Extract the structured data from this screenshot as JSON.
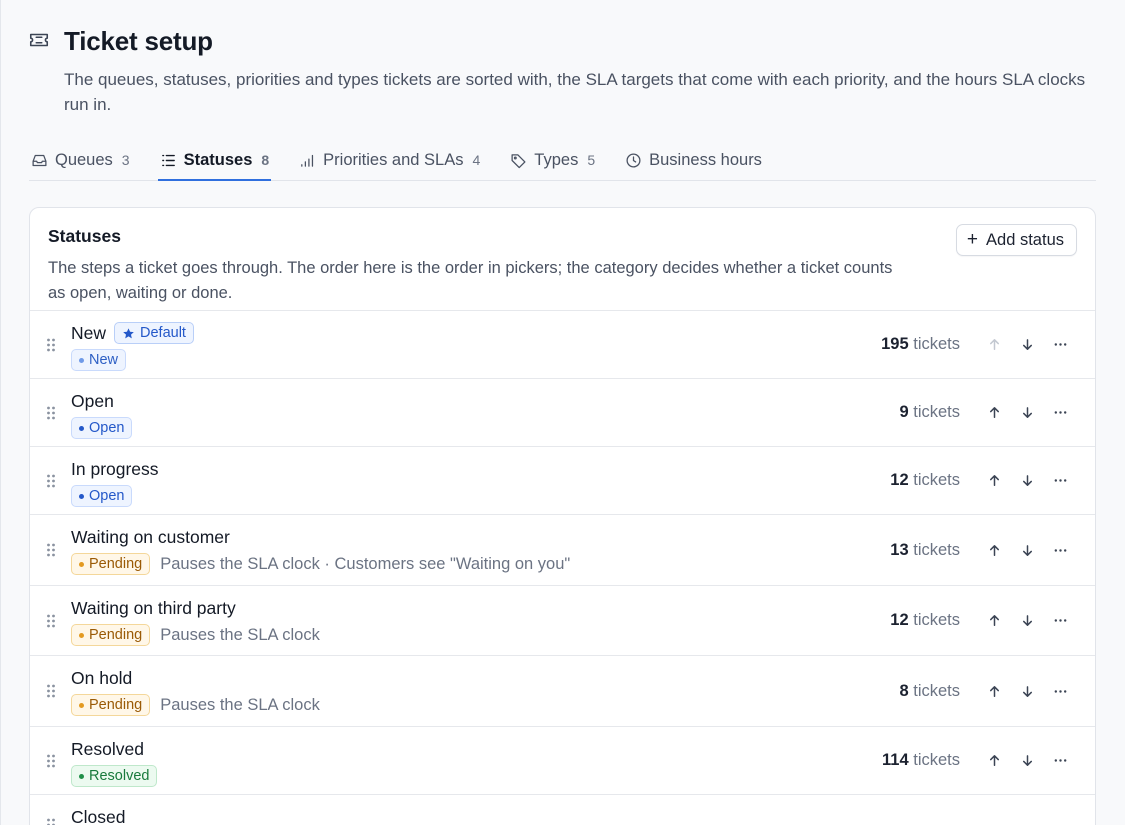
{
  "header": {
    "title": "Ticket setup",
    "subtitle": "The queues, statuses, priorities and types tickets are sorted with, the SLA targets that come with each priority, and the hours SLA clocks run in.",
    "icon": "ticket-icon"
  },
  "tabs": [
    {
      "label": "Queues",
      "count": "3",
      "icon": "inbox-icon",
      "active": false
    },
    {
      "label": "Statuses",
      "count": "8",
      "icon": "list-icon",
      "active": true
    },
    {
      "label": "Priorities and SLAs",
      "count": "4",
      "icon": "signal-icon",
      "active": false
    },
    {
      "label": "Types",
      "count": "5",
      "icon": "tag-icon",
      "active": false
    },
    {
      "label": "Business hours",
      "count": "",
      "icon": "clock-icon",
      "active": false
    }
  ],
  "card": {
    "title": "Statuses",
    "description": "The steps a ticket goes through. The order here is the order in pickers; the category decides whether a ticket counts as open, waiting or done.",
    "add_button": "Add status"
  },
  "tickets_suffix": "tickets",
  "default_label": "Default",
  "statuses": [
    {
      "name": "New",
      "category": "New",
      "category_class": "new",
      "is_default": true,
      "note": "",
      "count": "195",
      "can_move_up": false
    },
    {
      "name": "Open",
      "category": "Open",
      "category_class": "open",
      "is_default": false,
      "note": "",
      "count": "9",
      "can_move_up": true
    },
    {
      "name": "In progress",
      "category": "Open",
      "category_class": "open",
      "is_default": false,
      "note": "",
      "count": "12",
      "can_move_up": true
    },
    {
      "name": "Waiting on customer",
      "category": "Pending",
      "category_class": "pending",
      "is_default": false,
      "note": "Pauses the SLA clock · Customers see \"Waiting on you\"",
      "count": "13",
      "can_move_up": true
    },
    {
      "name": "Waiting on third party",
      "category": "Pending",
      "category_class": "pending",
      "is_default": false,
      "note": "Pauses the SLA clock",
      "count": "12",
      "can_move_up": true
    },
    {
      "name": "On hold",
      "category": "Pending",
      "category_class": "pending",
      "is_default": false,
      "note": "Pauses the SLA clock",
      "count": "8",
      "can_move_up": true
    },
    {
      "name": "Resolved",
      "category": "Resolved",
      "category_class": "resolved",
      "is_default": false,
      "note": "",
      "count": "114",
      "can_move_up": true
    },
    {
      "name": "Closed",
      "category": "",
      "category_class": "",
      "is_default": false,
      "note": "",
      "count": "",
      "can_move_up": true
    }
  ],
  "colors": {
    "accent": "#2f6fde",
    "new": "#2d5fc4",
    "pending": "#9a5a06",
    "resolved": "#187a3c"
  }
}
